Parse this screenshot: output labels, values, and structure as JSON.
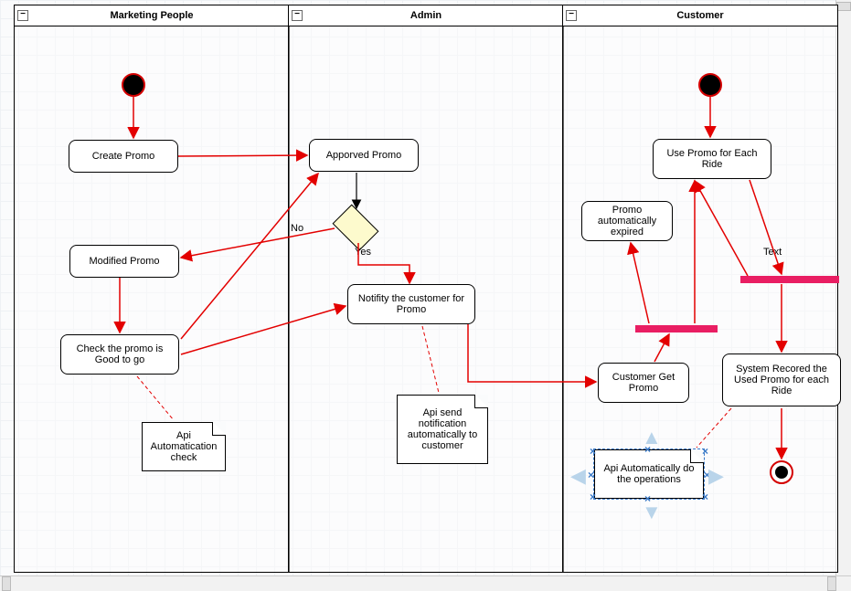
{
  "lanes": {
    "marketing": {
      "title": "Marketing People"
    },
    "admin": {
      "title": "Admin"
    },
    "customer": {
      "title": "Customer"
    }
  },
  "nodes": {
    "create_promo": "Create Promo",
    "modified_promo": "Modified Promo",
    "check_promo": "Check the promo is Good to go",
    "approved_promo": "Apporved Promo",
    "notify_customer": "Notifity the customer for Promo",
    "use_promo": "Use Promo for Each Ride",
    "promo_expired": "Promo automatically expired",
    "customer_get_promo": "Customer Get Promo",
    "system_record": "System Recored the Used Promo for each Ride"
  },
  "notes": {
    "api_auto_check": "Api Automatication check",
    "api_send_notification": "Api send notification automatically to customer",
    "api_auto_ops": "Api Automatically do the operations"
  },
  "labels": {
    "decision_no": "No",
    "decision_yes": "Yes",
    "text_edge": "Text"
  }
}
